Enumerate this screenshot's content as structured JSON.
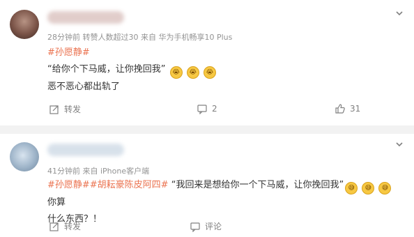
{
  "post1": {
    "meta": "28分钟前  转赞人数超过30  来自 华为手机畅享10 Plus",
    "tag": "#孙愿静#",
    "line1": "“给你个下马威，让你挽回我”",
    "line2": "恶不恶心都出轨了",
    "emoji_count": 3,
    "repost_label": "转发",
    "comment_count": "2",
    "like_count": "31"
  },
  "post2": {
    "meta": "41分钟前  来自 iPhone客户端",
    "tags": "#孙愿静##胡耘豪陈皮阿四#",
    "quote": "“我回来是想给你一个下马威，让你挽回我”",
    "after_emoji": "你算",
    "line2": "什么东西？！",
    "emoji_count": 3,
    "repost_label": "转发",
    "comment_label": "评论"
  },
  "icons": {
    "chevron": "chevron-down-icon",
    "repost": "repost-icon",
    "comment": "comment-icon",
    "like": "like-icon"
  },
  "colors": {
    "tag": "#eb7350",
    "meta": "#939393",
    "separator": "#f2f2f2"
  }
}
